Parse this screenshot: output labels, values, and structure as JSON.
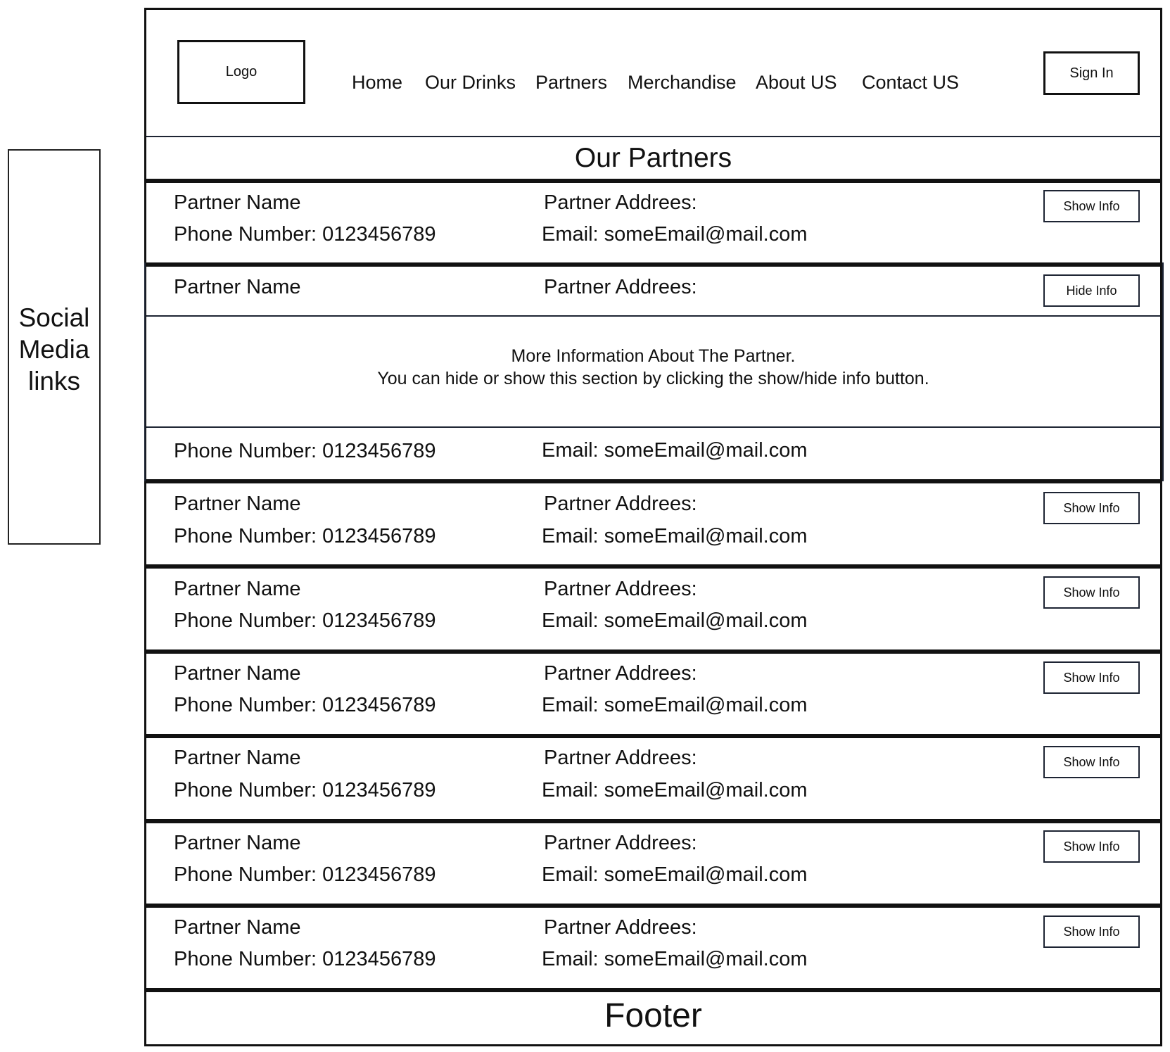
{
  "social": {
    "lines": [
      "Social",
      "Media",
      "links"
    ]
  },
  "header": {
    "logo_label": "Logo",
    "nav": [
      "Home",
      "Our Drinks",
      "Partners",
      "Merchandise",
      "About US",
      "Contact US"
    ],
    "sign_in_label": "Sign In"
  },
  "page_title": "Our Partners",
  "partners": [
    {
      "name": "Partner Name",
      "address": "Partner Addrees:",
      "phone": "Phone Number: 0123456789",
      "email": "Email: someEmail@mail.com",
      "button": "Show Info"
    },
    {
      "name": "Partner Name",
      "address": "Partner Addrees:",
      "phone": "Phone Number: 0123456789",
      "email": "Email: someEmail@mail.com",
      "button": "Hide Info",
      "more_info": [
        "More Information About The Partner.",
        "You can hide or show this section by clicking the show/hide info button."
      ]
    },
    {
      "name": "Partner Name",
      "address": "Partner Addrees:",
      "phone": "Phone Number: 0123456789",
      "email": "Email: someEmail@mail.com",
      "button": "Show Info"
    },
    {
      "name": "Partner Name",
      "address": "Partner Addrees:",
      "phone": "Phone Number: 0123456789",
      "email": "Email: someEmail@mail.com",
      "button": "Show Info"
    },
    {
      "name": "Partner Name",
      "address": "Partner Addrees:",
      "phone": "Phone Number: 0123456789",
      "email": "Email: someEmail@mail.com",
      "button": "Show Info"
    },
    {
      "name": "Partner Name",
      "address": "Partner Addrees:",
      "phone": "Phone Number: 0123456789",
      "email": "Email: someEmail@mail.com",
      "button": "Show Info"
    },
    {
      "name": "Partner Name",
      "address": "Partner Addrees:",
      "phone": "Phone Number: 0123456789",
      "email": "Email: someEmail@mail.com",
      "button": "Show Info"
    },
    {
      "name": "Partner Name",
      "address": "Partner Addrees:",
      "phone": "Phone Number: 0123456789",
      "email": "Email: someEmail@mail.com",
      "button": "Show Info"
    }
  ],
  "footer_label": "Footer"
}
